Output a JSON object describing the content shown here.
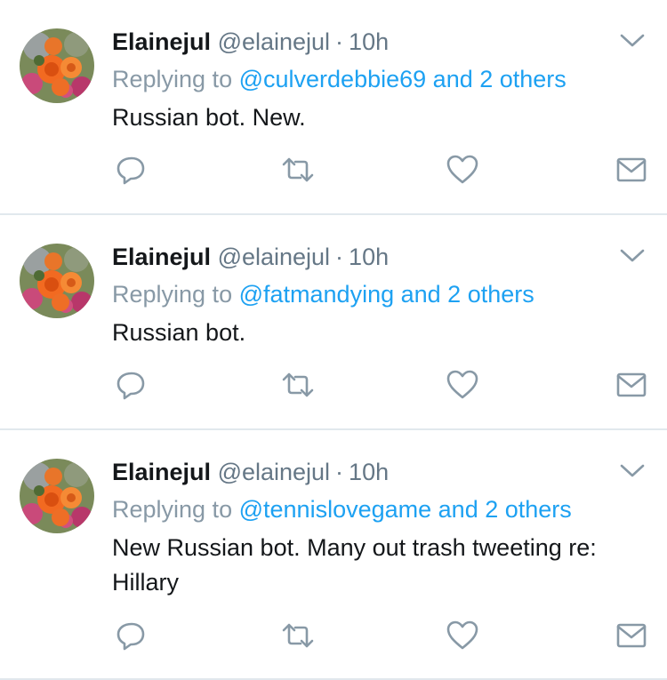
{
  "colors": {
    "name": "#14171a",
    "muted": "#657786",
    "reply_prefix": "#8899a6",
    "link": "#1da1f2",
    "icon": "#8899a6",
    "divider": "#e1e8ed"
  },
  "icons": {
    "reply": "speech-bubble-icon",
    "retweet": "retweet-arrows-icon",
    "like": "heart-icon",
    "dm": "envelope-icon",
    "menu": "chevron-down-icon"
  },
  "tweets": [
    {
      "name": "Elainejul",
      "handle": "@elainejul",
      "separator": "·",
      "time": "10h",
      "reply_prefix": "Replying to",
      "reply_mention": "@culverdebbie69",
      "reply_others": "and 2 others",
      "text": "Russian bot. New."
    },
    {
      "name": "Elainejul",
      "handle": "@elainejul",
      "separator": "·",
      "time": "10h",
      "reply_prefix": "Replying to",
      "reply_mention": "@fatmandying",
      "reply_others": "and 2 others",
      "text": "Russian bot."
    },
    {
      "name": "Elainejul",
      "handle": "@elainejul",
      "separator": "·",
      "time": "10h",
      "reply_prefix": "Replying to",
      "reply_mention": "@tennislovegame",
      "reply_others": "and 2 others",
      "text": "New Russian bot. Many out trash tweeting re: Hillary"
    }
  ]
}
